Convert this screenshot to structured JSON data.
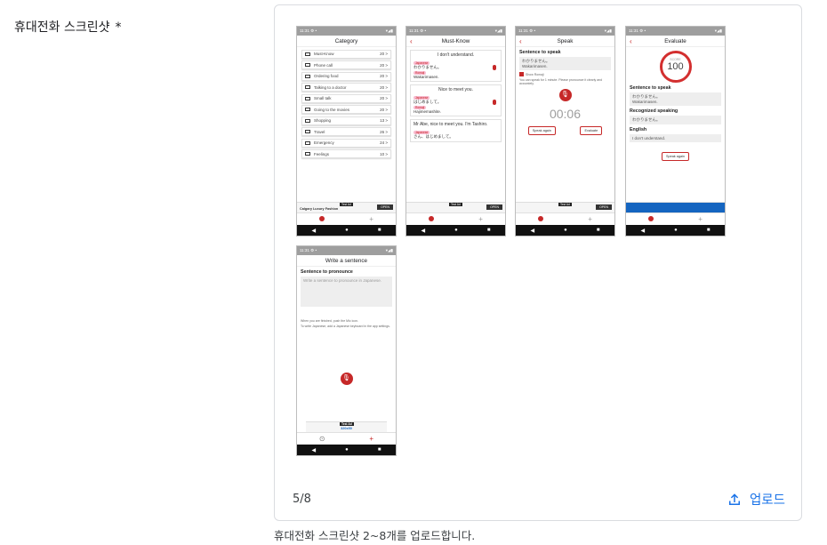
{
  "field": {
    "label": "휴대전화 스크린샷",
    "required_mark": "*"
  },
  "uploader": {
    "count": "5/8",
    "upload_label": "업로드",
    "helper": "휴대전화 스크린샷 2~8개를 업로드합니다."
  },
  "colors": {
    "accent": "#1a73e8",
    "brand": "#c62828"
  },
  "thumbs": {
    "category": {
      "title": "Category",
      "items": [
        {
          "label": "Must-Know",
          "count": "20 >"
        },
        {
          "label": "Phone call",
          "count": "20 >"
        },
        {
          "label": "Ordering food",
          "count": "20 >"
        },
        {
          "label": "Talking to a doctor",
          "count": "20 >"
        },
        {
          "label": "Small talk",
          "count": "20 >"
        },
        {
          "label": "Going to the movies",
          "count": "20 >"
        },
        {
          "label": "Shopping",
          "count": "13 >"
        },
        {
          "label": "Travel",
          "count": "26 >"
        },
        {
          "label": "Emergency",
          "count": "24 >"
        },
        {
          "label": "Feelings",
          "count": "10 >"
        }
      ],
      "ad_text": "Calgary Luxury Fashion",
      "ad_button": "OPEN"
    },
    "mustknow": {
      "title": "Must-Know",
      "cards": [
        {
          "en": "I don't understand.",
          "jp": "わかりません。",
          "romaji": "Wakarimasen."
        },
        {
          "en": "Nice to meet you.",
          "jp": "はじめまして。",
          "romaji": "Hajimemashite."
        },
        {
          "en": "Mr Abe, nice to meet you. I'm Tashiro.",
          "jp": "さん、はじめまして。",
          "romaji": ""
        }
      ],
      "pill_jp": "Japanese",
      "pill_romaji": "Romaji",
      "ad_button": "OPEN"
    },
    "speak": {
      "title": "Speak",
      "section": "Sentence to speak",
      "jp": "わかりません。",
      "romaji": "Wakarimasen.",
      "checkbox": "Show Romaji",
      "hint": "You can speak for 1 minute. Please pronounce it clearly and accurately.",
      "timer": "00:06",
      "btn_again": "Speak again",
      "btn_eval": "Evaluate",
      "ad_button": "OPEN"
    },
    "evaluate": {
      "title": "Evaluate",
      "score_label": "SCORE",
      "score": "100",
      "s1": "Sentence to speak",
      "s1_jp": "わかりません。",
      "s1_romaji": "Wakarimasen.",
      "s2": "Recognized speaking",
      "s2_val": "わかりません。",
      "s3": "English",
      "s3_val": "I don't understand.",
      "btn": "Speak again"
    },
    "write": {
      "title": "Write a sentence",
      "section": "Sentence to pronounce",
      "placeholder": "Write a sentence to pronounce in Japanese.",
      "hint1": "When you are finished, push the Mic icon.",
      "hint2": "To write Japanese, add a Japanese keyboard in the app settings.",
      "ad_text": "320x50"
    }
  }
}
